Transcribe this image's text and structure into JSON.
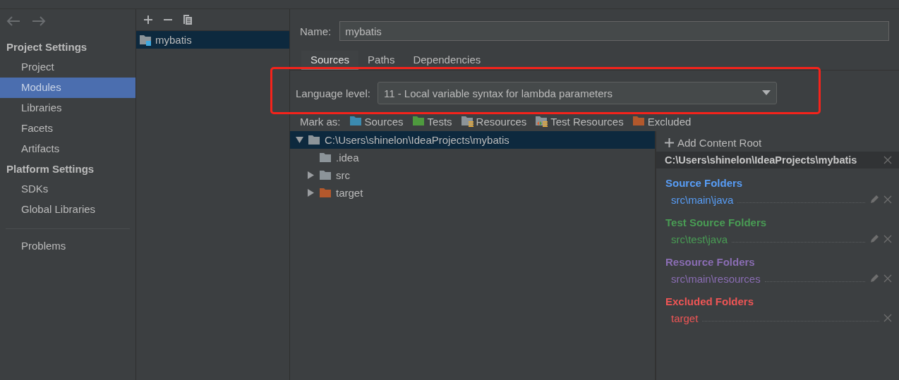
{
  "sidebar": {
    "groups": [
      {
        "title": "Project Settings",
        "items": [
          {
            "label": "Project",
            "selected": false
          },
          {
            "label": "Modules",
            "selected": true
          },
          {
            "label": "Libraries",
            "selected": false
          },
          {
            "label": "Facets",
            "selected": false
          },
          {
            "label": "Artifacts",
            "selected": false
          }
        ]
      },
      {
        "title": "Platform Settings",
        "items": [
          {
            "label": "SDKs",
            "selected": false
          },
          {
            "label": "Global Libraries",
            "selected": false
          }
        ]
      }
    ],
    "extra_items": [
      {
        "label": "Problems",
        "selected": false
      }
    ]
  },
  "modules": {
    "items": [
      {
        "name": "mybatis",
        "selected": true
      }
    ]
  },
  "editor": {
    "name_label": "Name:",
    "name_value": "mybatis",
    "tabs": [
      {
        "label": "Sources",
        "selected": true
      },
      {
        "label": "Paths",
        "selected": false
      },
      {
        "label": "Dependencies",
        "selected": false
      }
    ],
    "language_level": {
      "label": "Language level:",
      "value": "11 - Local variable syntax for lambda parameters",
      "highlighted": true
    },
    "mark_as": {
      "label": "Mark as:",
      "options": [
        {
          "label": "Sources",
          "kind": "sources"
        },
        {
          "label": "Tests",
          "kind": "tests"
        },
        {
          "label": "Resources",
          "kind": "resources"
        },
        {
          "label": "Test Resources",
          "kind": "test_resources"
        },
        {
          "label": "Excluded",
          "kind": "excluded"
        }
      ]
    }
  },
  "tree": {
    "root": {
      "label": "C:\\Users\\shinelon\\IdeaProjects\\mybatis",
      "kind": "plain",
      "expanded": true,
      "selected": true,
      "children": [
        {
          "label": ".idea",
          "kind": "plain",
          "expandable": false
        },
        {
          "label": "src",
          "kind": "plain",
          "expandable": true
        },
        {
          "label": "target",
          "kind": "excluded",
          "expandable": true
        }
      ]
    }
  },
  "roots_panel": {
    "add_label": "Add Content Root",
    "root_path": "C:\\Users\\shinelon\\IdeaProjects\\mybatis",
    "sections": [
      {
        "title": "Source Folders",
        "color": "#589df6",
        "folders": [
          {
            "path": "src\\main\\java",
            "editable": true
          }
        ]
      },
      {
        "title": "Test Source Folders",
        "color": "#499c54",
        "folders": [
          {
            "path": "src\\test\\java",
            "editable": true
          }
        ]
      },
      {
        "title": "Resource Folders",
        "color": "#8a6db3",
        "folders": [
          {
            "path": "src\\main\\resources",
            "editable": true
          }
        ]
      },
      {
        "title": "Excluded Folders",
        "color": "#ee5555",
        "folders": [
          {
            "path": "target",
            "editable": false
          }
        ]
      }
    ]
  }
}
